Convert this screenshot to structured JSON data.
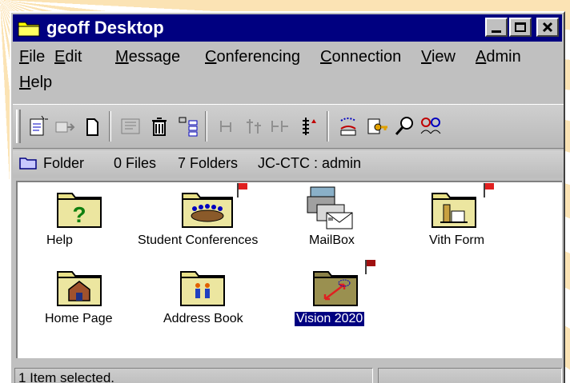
{
  "window": {
    "title": "geoff Desktop",
    "buttons": {
      "minimize": "_",
      "maximize": "□",
      "close": "×"
    }
  },
  "menu": {
    "items": [
      {
        "label": "File",
        "key": "F",
        "rest": "ile"
      },
      {
        "label": "Edit",
        "key": "E",
        "rest": "dit"
      },
      {
        "label": "Message",
        "key": "M",
        "rest": "essage"
      },
      {
        "label": "Conferencing",
        "key": "C",
        "rest": "onferencing"
      },
      {
        "label": "Connection",
        "key": "C",
        "rest": "onnection"
      },
      {
        "label": "View",
        "key": "V",
        "rest": "iew"
      },
      {
        "label": "Admin",
        "key": "A",
        "rest": "dmin"
      },
      {
        "label": "Help",
        "key": "H",
        "rest": "elp"
      }
    ]
  },
  "toolbar": {
    "icons": [
      "new-document-icon",
      "forward-icon",
      "blank-page-icon",
      "properties-icon",
      "trash-icon",
      "list-view-icon",
      "cut-icon",
      "copy-icon",
      "paste-icon",
      "sort-icon",
      "connect-icon",
      "key-icon",
      "search-icon",
      "people-icon"
    ]
  },
  "infobar": {
    "type": "Folder",
    "files": "0 Files",
    "folders": "7 Folders",
    "server": "JC-CTC : admin"
  },
  "items": [
    {
      "label": "Help",
      "icon": "help-folder-icon",
      "flag": false,
      "selected": false
    },
    {
      "label": "Student Conferences",
      "icon": "conference-folder-icon",
      "flag": true,
      "selected": false
    },
    {
      "label": "MailBox",
      "icon": "mailbox-icon",
      "flag": false,
      "selected": false
    },
    {
      "label": "Vith Form",
      "icon": "form-folder-icon",
      "flag": true,
      "selected": false
    },
    {
      "label": "Home Page",
      "icon": "home-folder-icon",
      "flag": false,
      "selected": false
    },
    {
      "label": "Address Book",
      "icon": "address-book-folder-icon",
      "flag": false,
      "selected": false
    },
    {
      "label": "Vision 2020",
      "icon": "vision-folder-icon",
      "flag": true,
      "selected": true
    }
  ],
  "status": {
    "text": "1 Item selected.",
    "right": ""
  },
  "colors": {
    "titlebar": "#000080",
    "selection": "#000080",
    "flag": "#e02020",
    "folder": "#e8e088"
  }
}
